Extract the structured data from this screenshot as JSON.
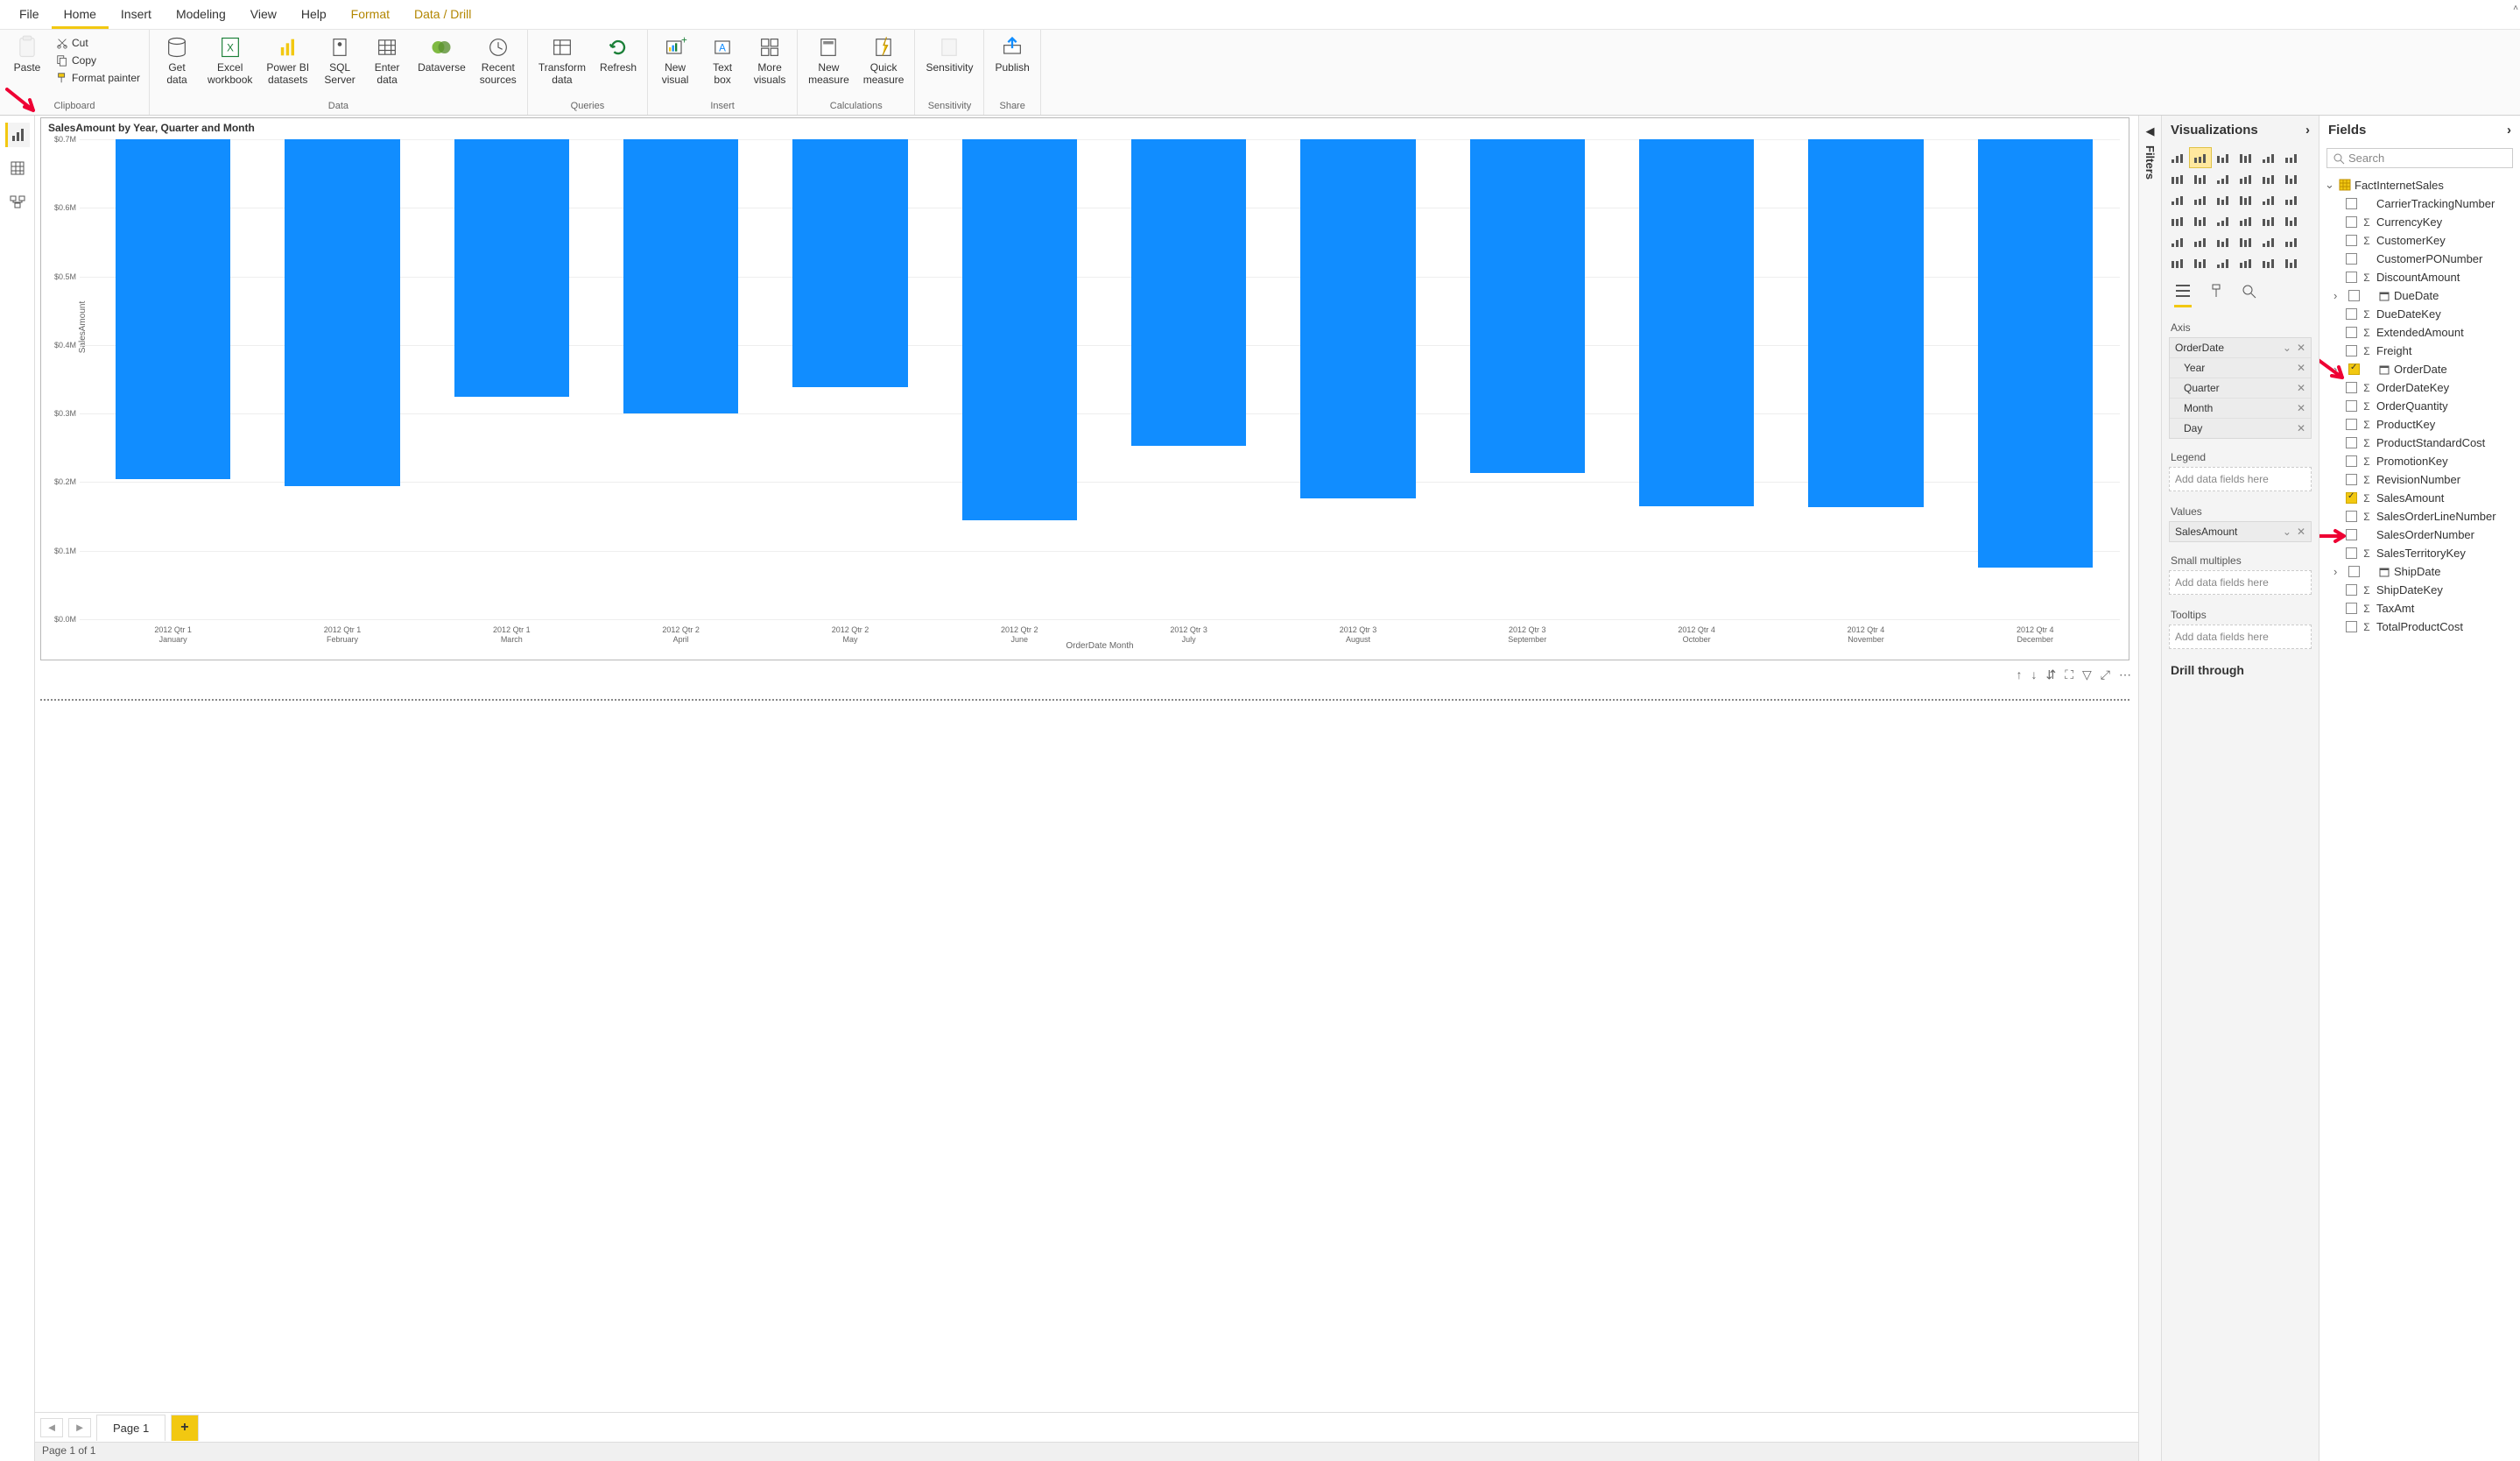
{
  "menubar": [
    "File",
    "Home",
    "Insert",
    "Modeling",
    "View",
    "Help",
    "Format",
    "Data / Drill"
  ],
  "menubar_active": 1,
  "menubar_highlight": [
    6,
    7
  ],
  "ribbon": {
    "clipboard": {
      "label": "Clipboard",
      "paste": "Paste",
      "cut": "Cut",
      "copy": "Copy",
      "format_painter": "Format painter"
    },
    "data": {
      "label": "Data",
      "get_data": "Get\ndata",
      "excel": "Excel\nworkbook",
      "pbi": "Power BI\ndatasets",
      "sql": "SQL\nServer",
      "enter": "Enter\ndata",
      "dataverse": "Dataverse",
      "recent": "Recent\nsources"
    },
    "queries": {
      "label": "Queries",
      "transform": "Transform\ndata",
      "refresh": "Refresh"
    },
    "insert": {
      "label": "Insert",
      "new_visual": "New\nvisual",
      "text_box": "Text\nbox",
      "more": "More\nvisuals"
    },
    "calc": {
      "label": "Calculations",
      "new_measure": "New\nmeasure",
      "quick": "Quick\nmeasure"
    },
    "sens": {
      "label": "Sensitivity",
      "btn": "Sensitivity"
    },
    "share": {
      "label": "Share",
      "publish": "Publish"
    }
  },
  "chart_data": {
    "type": "bar",
    "title": "SalesAmount by Year, Quarter and Month",
    "ylabel": "SalesAmount",
    "xlabel": "OrderDate Month",
    "ylim": [
      0,
      0.7
    ],
    "yticks": [
      "$0.0M",
      "$0.1M",
      "$0.2M",
      "$0.3M",
      "$0.4M",
      "$0.5M",
      "$0.6M",
      "$0.7M"
    ],
    "categories": [
      "2012 Qtr 1 January",
      "2012 Qtr 1 February",
      "2012 Qtr 1 March",
      "2012 Qtr 2 April",
      "2012 Qtr 2 May",
      "2012 Qtr 2 June",
      "2012 Qtr 3 July",
      "2012 Qtr 3 August",
      "2012 Qtr 3 September",
      "2012 Qtr 4 October",
      "2012 Qtr 4 November",
      "2012 Qtr 4 December"
    ],
    "values": [
      0.495,
      0.506,
      0.375,
      0.4,
      0.362,
      0.556,
      0.447,
      0.524,
      0.487,
      0.535,
      0.537,
      0.624
    ]
  },
  "visual_toolbar": [
    "↑",
    "↓",
    "⇵",
    "⛶",
    "▽",
    "⤢",
    "⋯"
  ],
  "pages": {
    "current": "Page 1",
    "status": "Page 1 of 1"
  },
  "filters_label": "Filters",
  "viz_pane": {
    "title": "Visualizations",
    "wells": {
      "axis_label": "Axis",
      "axis": [
        "OrderDate",
        "Year",
        "Quarter",
        "Month",
        "Day"
      ],
      "legend_label": "Legend",
      "legend_placeholder": "Add data fields here",
      "values_label": "Values",
      "values": [
        "SalesAmount"
      ],
      "small_label": "Small multiples",
      "small_placeholder": "Add data fields here",
      "tooltips_label": "Tooltips",
      "tooltips_placeholder": "Add data fields here",
      "drill_label": "Drill through"
    }
  },
  "fields_pane": {
    "title": "Fields",
    "search": "Search",
    "table": "FactInternetSales",
    "rows": [
      {
        "name": "CarrierTrackingNumber",
        "sigma": false,
        "checked": false
      },
      {
        "name": "CurrencyKey",
        "sigma": true,
        "checked": false
      },
      {
        "name": "CustomerKey",
        "sigma": true,
        "checked": false
      },
      {
        "name": "CustomerPONumber",
        "sigma": false,
        "checked": false
      },
      {
        "name": "DiscountAmount",
        "sigma": true,
        "checked": false
      },
      {
        "name": "DueDate",
        "sigma": false,
        "checked": false,
        "date": true,
        "expand": true
      },
      {
        "name": "DueDateKey",
        "sigma": true,
        "checked": false
      },
      {
        "name": "ExtendedAmount",
        "sigma": true,
        "checked": false
      },
      {
        "name": "Freight",
        "sigma": true,
        "checked": false
      },
      {
        "name": "OrderDate",
        "sigma": false,
        "checked": true,
        "date": true,
        "expand": true
      },
      {
        "name": "OrderDateKey",
        "sigma": true,
        "checked": false
      },
      {
        "name": "OrderQuantity",
        "sigma": true,
        "checked": false
      },
      {
        "name": "ProductKey",
        "sigma": true,
        "checked": false
      },
      {
        "name": "ProductStandardCost",
        "sigma": true,
        "checked": false
      },
      {
        "name": "PromotionKey",
        "sigma": true,
        "checked": false
      },
      {
        "name": "RevisionNumber",
        "sigma": true,
        "checked": false
      },
      {
        "name": "SalesAmount",
        "sigma": true,
        "checked": true
      },
      {
        "name": "SalesOrderLineNumber",
        "sigma": true,
        "checked": false
      },
      {
        "name": "SalesOrderNumber",
        "sigma": false,
        "checked": false
      },
      {
        "name": "SalesTerritoryKey",
        "sigma": true,
        "checked": false
      },
      {
        "name": "ShipDate",
        "sigma": false,
        "checked": false,
        "date": true,
        "expand": true
      },
      {
        "name": "ShipDateKey",
        "sigma": true,
        "checked": false
      },
      {
        "name": "TaxAmt",
        "sigma": true,
        "checked": false
      },
      {
        "name": "TotalProductCost",
        "sigma": true,
        "checked": false
      }
    ]
  }
}
